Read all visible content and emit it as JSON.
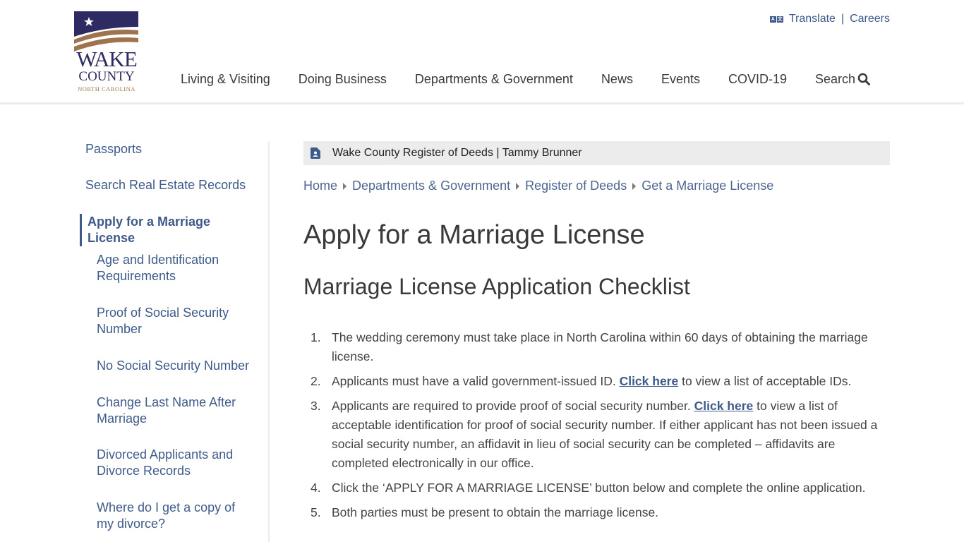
{
  "header": {
    "logo": {
      "line1": "WAKE",
      "line2": "COUNTY",
      "line3": "NORTH CAROLINA",
      "colors": {
        "navy": "#2e2a62",
        "tan": "#a0734f"
      }
    },
    "utility": {
      "translate_icon": "translate-icon",
      "translate_label": "Translate",
      "separator": "|",
      "careers_label": "Careers"
    },
    "nav": [
      {
        "label": "Living & Visiting"
      },
      {
        "label": "Doing Business"
      },
      {
        "label": "Departments & Government"
      },
      {
        "label": "News"
      },
      {
        "label": "Events"
      },
      {
        "label": "COVID-19"
      },
      {
        "label": "Search",
        "icon": "search-icon"
      }
    ]
  },
  "sidebar": {
    "items": [
      {
        "label": "Passports",
        "level": "top"
      },
      {
        "label": "Search Real Estate Records",
        "level": "top"
      },
      {
        "label": "Apply for a Marriage License",
        "level": "active"
      },
      {
        "label": "Age and Identification Requirements",
        "level": "sub"
      },
      {
        "label": "Proof of Social Security Number",
        "level": "sub"
      },
      {
        "label": "No Social Security Number",
        "level": "sub"
      },
      {
        "label": "Change Last Name After Marriage",
        "level": "sub"
      },
      {
        "label": "Divorced Applicants and Divorce Records",
        "level": "sub"
      },
      {
        "label": "Where do I get a copy of my divorce?",
        "level": "sub"
      }
    ]
  },
  "banner": {
    "icon": "contact-card-icon",
    "text": "Wake County Register of Deeds | Tammy Brunner"
  },
  "breadcrumb": [
    {
      "label": "Home"
    },
    {
      "label": "Departments & Government"
    },
    {
      "label": "Register of Deeds"
    },
    {
      "label": "Get a Marriage License"
    }
  ],
  "main": {
    "title": "Apply for a Marriage License",
    "subtitle": "Marriage License Application Checklist",
    "checklist": [
      {
        "num": "1.",
        "before": "The wedding ceremony must take place in North Carolina within 60 days of obtaining the marriage license.",
        "link": "",
        "after": ""
      },
      {
        "num": "2.",
        "before": "Applicants must have a valid government-issued ID. ",
        "link": "Click here",
        "after": " to view a list of acceptable IDs."
      },
      {
        "num": "3.",
        "before": "Applicants are required to provide proof of social security number. ",
        "link": "Click here",
        "after": " to view a list of acceptable identification for proof of social security number. If either applicant has not been issued a social security number, an affidavit in lieu of social security can be completed – affidavits are completed electronically in our office."
      },
      {
        "num": "4.",
        "before": "Click the ‘APPLY FOR A MARRIAGE LICENSE’ button below and complete the online application.",
        "link": "",
        "after": ""
      },
      {
        "num": "5.",
        "before": "Both parties must be present to obtain the marriage license.",
        "link": "",
        "after": ""
      }
    ]
  },
  "colors": {
    "link": "#3e5a8a",
    "text": "#444444",
    "heading": "#3a3a3a",
    "banner_bg": "#ececec"
  }
}
